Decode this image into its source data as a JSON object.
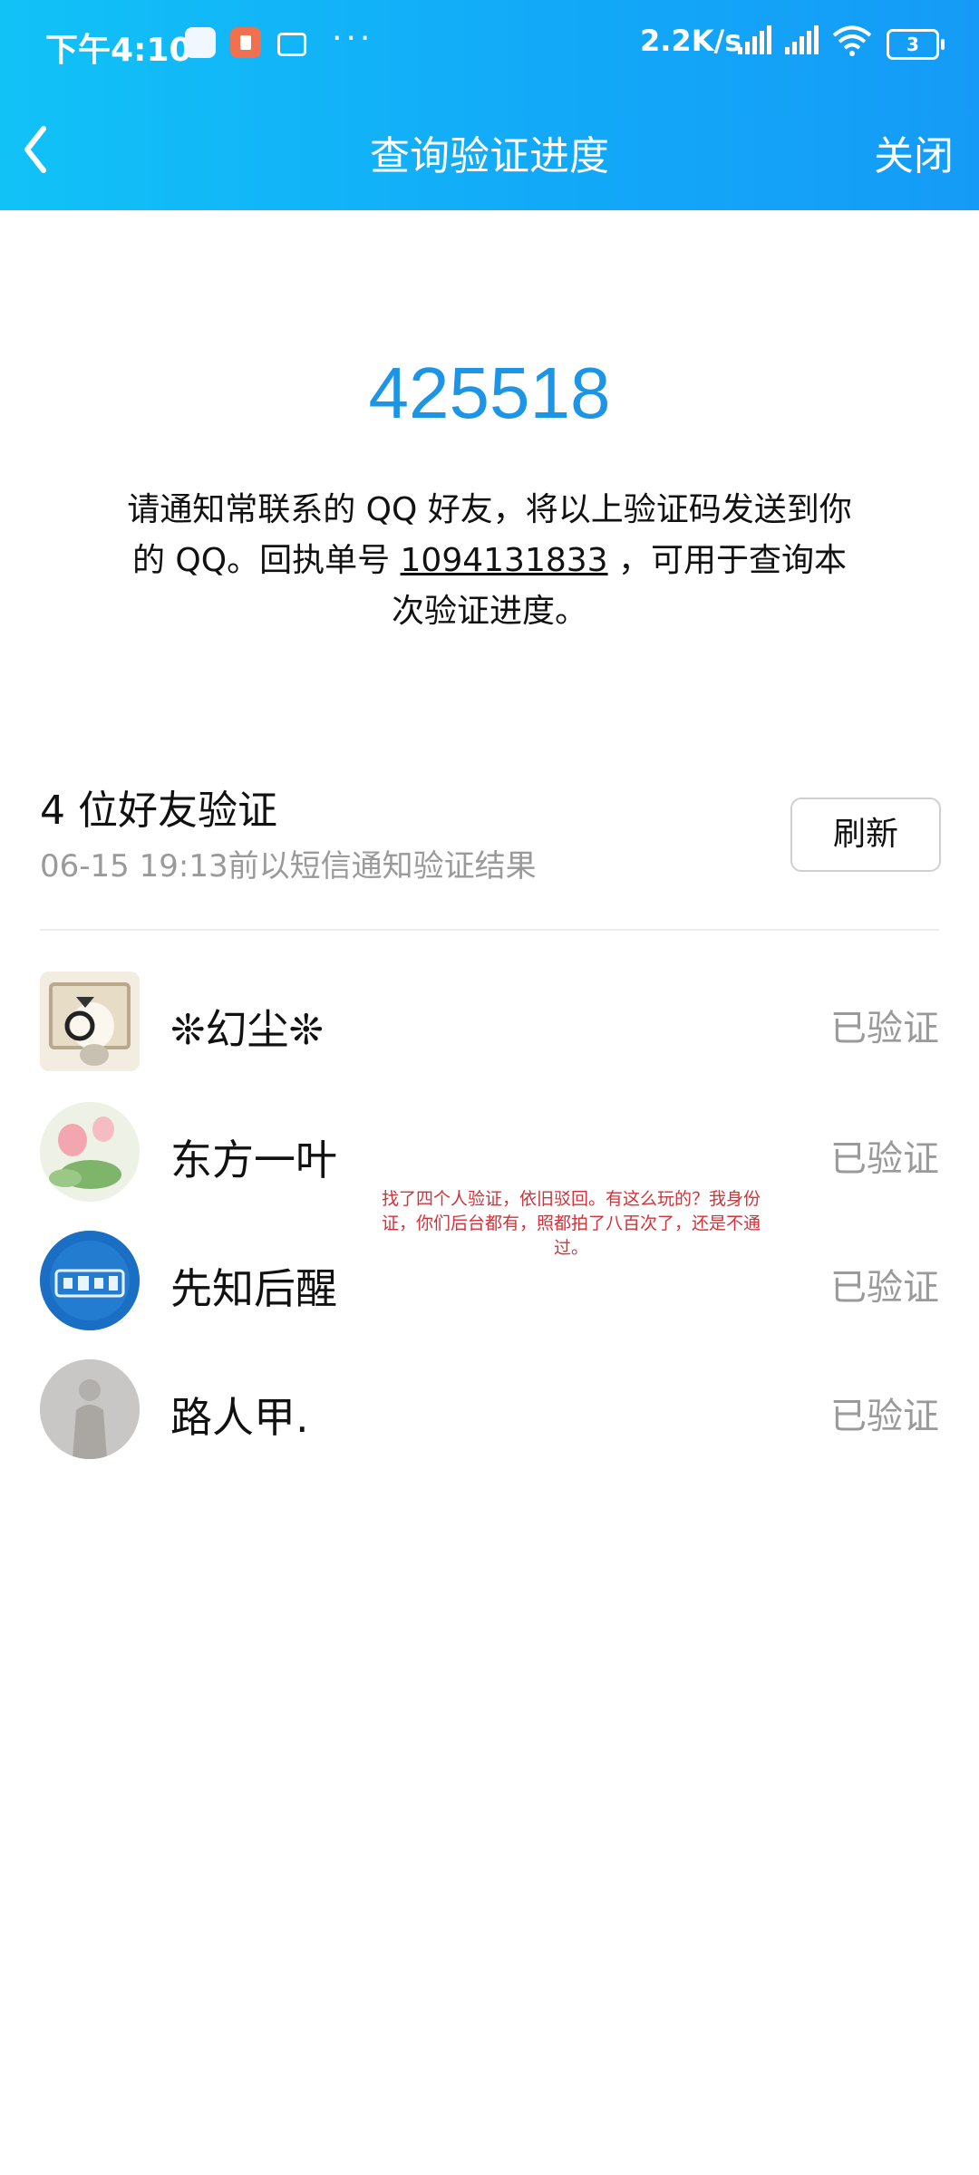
{
  "status_bar": {
    "time": "下午4:10",
    "more": "···",
    "net_speed": "2.2K/s",
    "battery": "3"
  },
  "nav": {
    "title": "查询验证进度",
    "close_label": "关闭"
  },
  "verification": {
    "code": "425518",
    "instruction_part1": "请通知常联系的 QQ 好友，将以上验证码发送到你的 QQ。回执单号 ",
    "ticket_number": "1094131833",
    "instruction_part2": " ，可用于查询本次验证进度。"
  },
  "friends_section": {
    "title": "4 位好友验证",
    "subtitle": "06-15 19:13前以短信通知验证结果",
    "refresh_label": "刷新",
    "items": [
      {
        "name": "❊幻尘❊",
        "status": "已验证"
      },
      {
        "name": "东方一叶",
        "status": "已验证"
      },
      {
        "name": "先知后醒",
        "status": "已验证"
      },
      {
        "name": "路人甲.",
        "status": "已验证"
      }
    ]
  },
  "annotation": {
    "text": "找了四个人验证，依旧驳回。有这么玩的？我身份证，你们后台都有，照都拍了八百次了，还是不通过。"
  },
  "colors": {
    "header_start": "#11c2f7",
    "header_end": "#159bf7",
    "code": "#1d95e6",
    "annotation": "#d0333a"
  }
}
